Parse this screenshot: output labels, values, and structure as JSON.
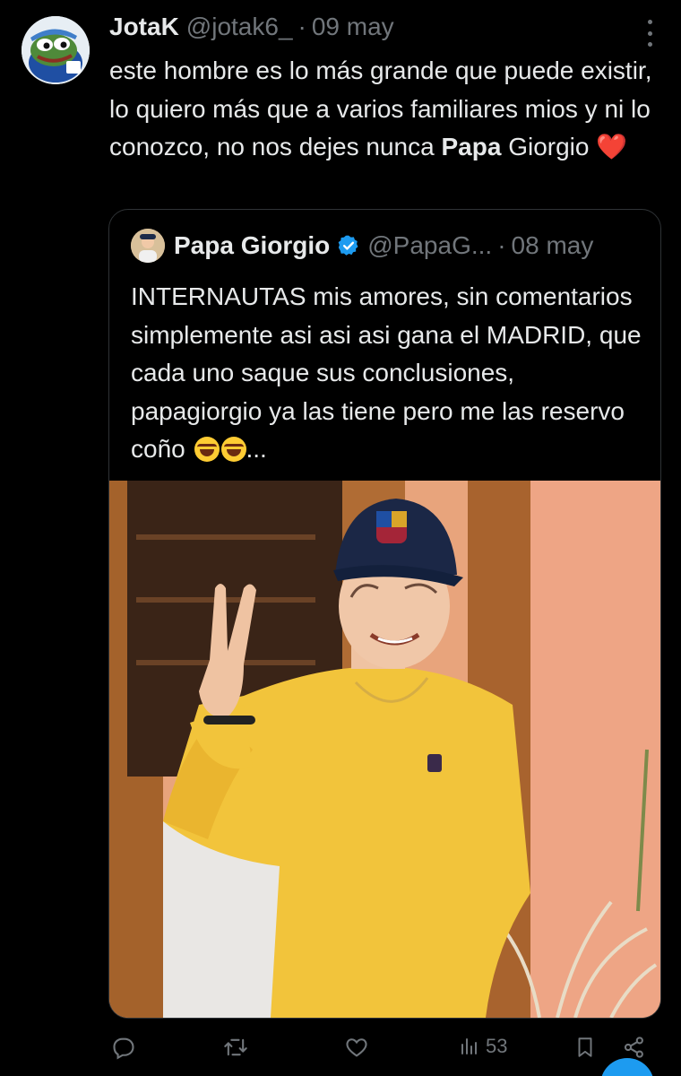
{
  "tweet": {
    "author_name": "JotaK",
    "author_handle": "@jotak6_",
    "separator": "·",
    "date": "09 may",
    "text_part1": "este hombre es lo más grande que puede existir, lo quiero más que a varios familiares mios y ni lo conozco, no nos dejes nunca ",
    "text_bold": "Papa",
    "text_part2": " Giorgio ",
    "heart": "❤️"
  },
  "quote": {
    "author_name": "Papa Giorgio",
    "author_handle": "@PapaG...",
    "separator": "·",
    "date": "08 may",
    "text": "INTERNAUTAS mis amores, sin comentarios simplemente asi asi asi gana el MADRID, que cada uno saque sus conclusiones, papagiorgio ya las tiene pero me las reservo coño ",
    "ellipsis": "..."
  },
  "actions": {
    "views_count": "53"
  },
  "icons": {
    "more": "more-vertical-icon",
    "verified": "verified-badge-icon",
    "reply": "reply-icon",
    "retweet": "retweet-icon",
    "like": "heart-icon",
    "views": "views-icon",
    "bookmark": "bookmark-icon",
    "share": "share-icon"
  },
  "colors": {
    "background": "#000000",
    "text": "#e7e9ea",
    "muted": "#71767b",
    "verified": "#1d9bf0",
    "heart": "#f91880"
  }
}
